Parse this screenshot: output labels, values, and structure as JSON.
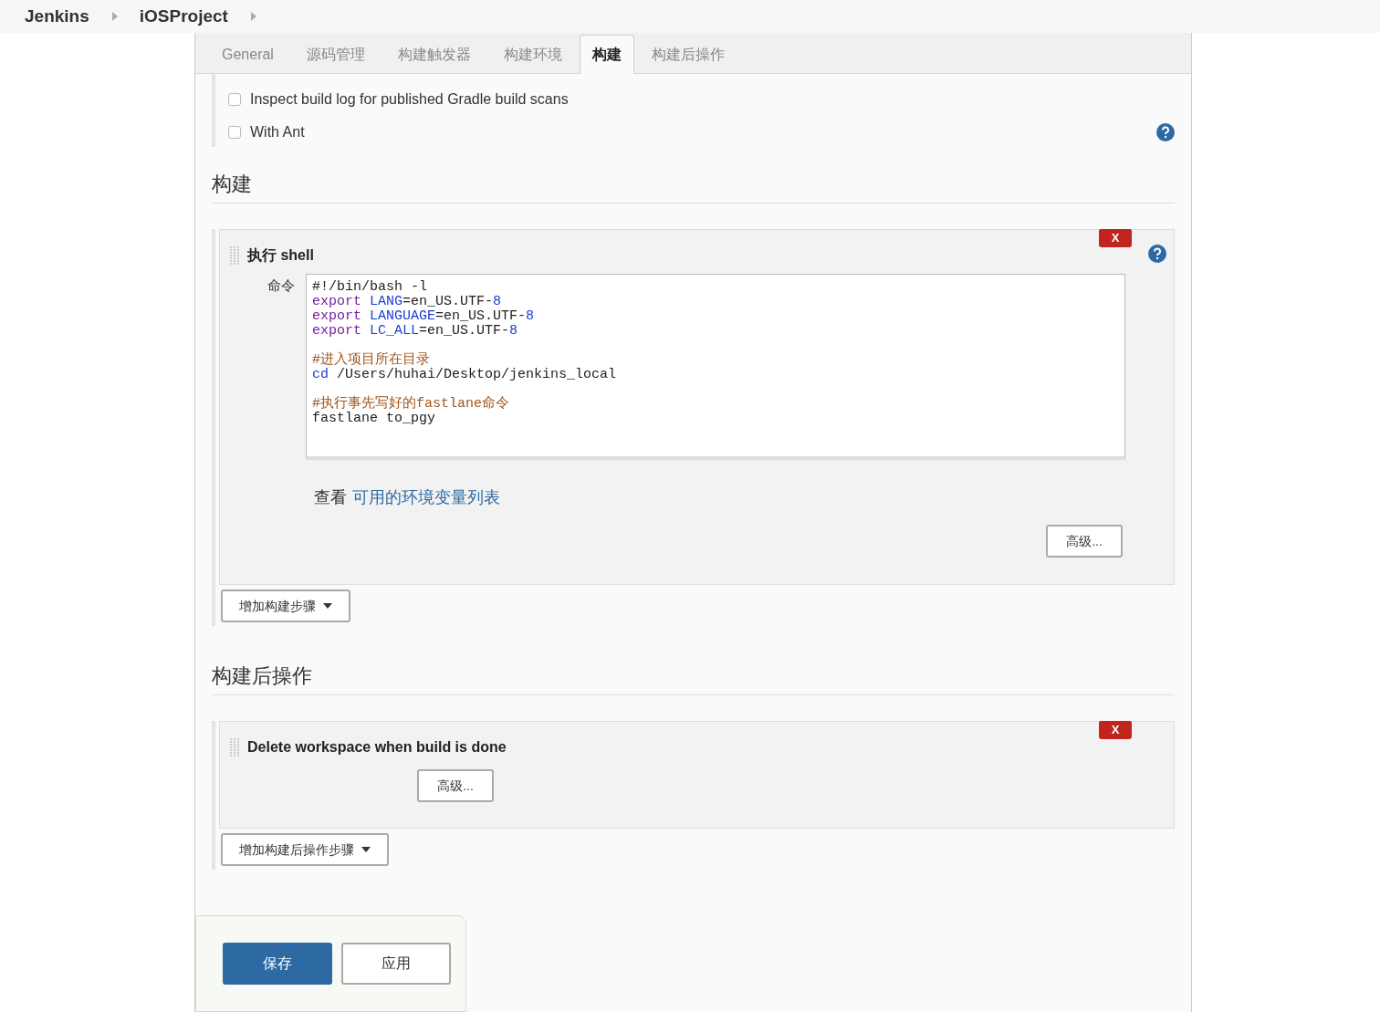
{
  "breadcrumbs": [
    {
      "label": "Jenkins"
    },
    {
      "label": "iOSProject"
    }
  ],
  "tabs": [
    {
      "label": "General",
      "selected": false
    },
    {
      "label": "源码管理",
      "selected": false
    },
    {
      "label": "构建触发器",
      "selected": false
    },
    {
      "label": "构建环境",
      "selected": false
    },
    {
      "label": "构建",
      "selected": true
    },
    {
      "label": "构建后操作",
      "selected": false
    }
  ],
  "env_options": [
    {
      "label": "Inspect build log for published Gradle build scans",
      "checked": false,
      "help": false
    },
    {
      "label": "With Ant",
      "checked": false,
      "help": true
    }
  ],
  "build_section": {
    "title": "构建",
    "step": {
      "title": "执行 shell",
      "delete_label": "X",
      "field_label": "命令",
      "code_blocks": [
        [
          [
            {
              "kind": "plain",
              "text": "#!/bin/bash -l"
            }
          ],
          [
            {
              "kind": "keyword",
              "text": "export "
            },
            {
              "kind": "variable",
              "text": "LANG"
            },
            {
              "kind": "plain",
              "text": "=en_US.UTF-"
            },
            {
              "kind": "number",
              "text": "8"
            }
          ],
          [
            {
              "kind": "keyword",
              "text": "export "
            },
            {
              "kind": "variable",
              "text": "LANGUAGE"
            },
            {
              "kind": "plain",
              "text": "=en_US.UTF-"
            },
            {
              "kind": "number",
              "text": "8"
            }
          ],
          [
            {
              "kind": "keyword",
              "text": "export "
            },
            {
              "kind": "variable",
              "text": "LC_ALL"
            },
            {
              "kind": "plain",
              "text": "=en_US.UTF-"
            },
            {
              "kind": "number",
              "text": "8"
            }
          ]
        ],
        [
          [
            {
              "kind": "comment",
              "text": "#进入项目所在目录"
            }
          ],
          [
            {
              "kind": "variable",
              "text": "cd "
            },
            {
              "kind": "plain",
              "text": "/Users/huhai/Desktop/jenkins_local"
            }
          ]
        ],
        [
          [
            {
              "kind": "comment",
              "text": "#执行事先写好的fastlane命令"
            }
          ],
          [
            {
              "kind": "plain",
              "text": "fastlane to_pgy"
            }
          ]
        ]
      ],
      "env_hint": "查看",
      "env_link": "可用的环境变量列表",
      "advanced_button": "高级..."
    },
    "add_button": "增加构建步骤"
  },
  "post_section": {
    "title": "构建后操作",
    "step": {
      "title": "Delete workspace when build is done",
      "delete_label": "X",
      "advanced_button": "高级..."
    },
    "add_button": "增加构建后操作步骤"
  },
  "actions": [
    {
      "label": "保存",
      "kind": "primary"
    },
    {
      "label": "应用",
      "kind": "secondary"
    }
  ]
}
